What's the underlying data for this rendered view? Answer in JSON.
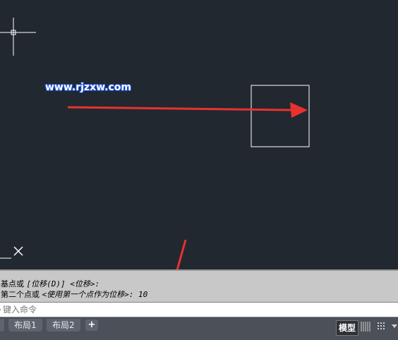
{
  "watermark": "www.rjzxw.com",
  "history": {
    "line1_a": "基点或 ",
    "line1_b": "[位移(D)] <位移>",
    "line1_c": ":",
    "line2_a": "第二个点或 ",
    "line2_b": "<使用第一个点作为位移>",
    "line2_c": ": 10"
  },
  "command": {
    "placeholder": "键入命令"
  },
  "tabs": {
    "layout1": "布局1",
    "layout2": "布局2",
    "add": "+"
  },
  "status": {
    "model": "模型"
  },
  "colors": {
    "canvas": "#212830",
    "arrow": "#e8322f",
    "history_bg": "#c8c8c8",
    "tabbar": "#4b5059"
  },
  "icons": {
    "crosshair": "crosshair-icon",
    "ucs": "ucs-icon",
    "grid": "grid-icon",
    "snap": "snap-icon",
    "menu": "chevron-down-icon"
  }
}
